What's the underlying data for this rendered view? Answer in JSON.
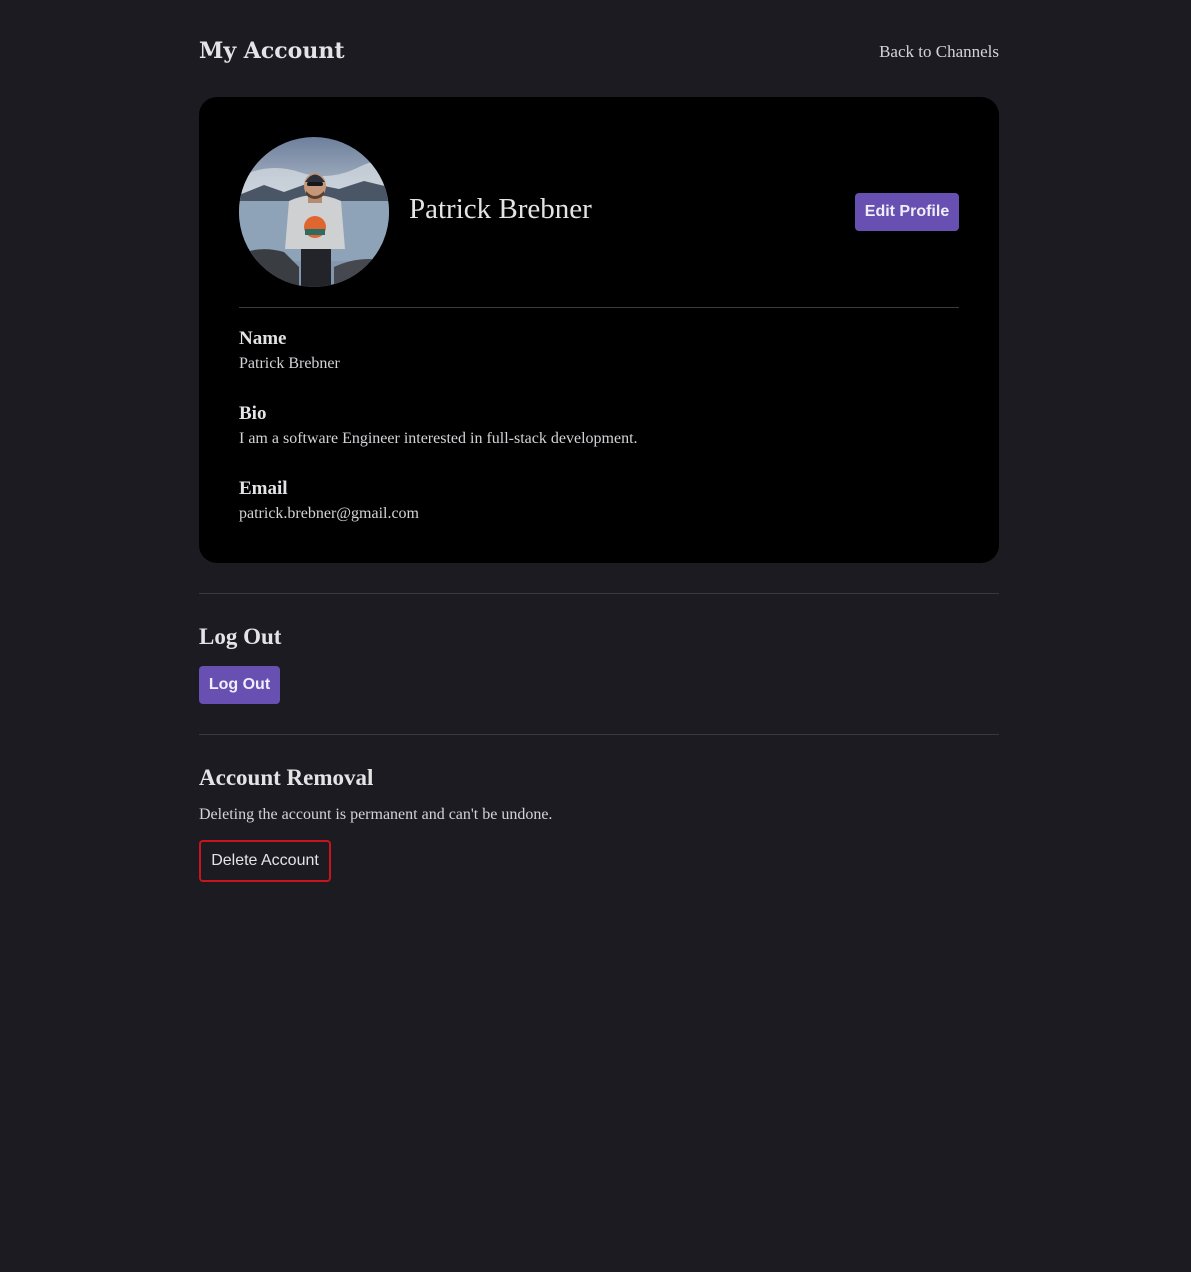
{
  "header": {
    "title": "My Account",
    "back_link": "Back to Channels"
  },
  "profile": {
    "display_name": "Patrick Brebner",
    "edit_button": "Edit Profile",
    "avatar_alt": "Profile photo",
    "fields": [
      {
        "label": "Name",
        "value": "Patrick Brebner"
      },
      {
        "label": "Bio",
        "value": "I am a software Engineer interested in full-stack development."
      },
      {
        "label": "Email",
        "value": "patrick.brebner@gmail.com"
      }
    ]
  },
  "logout": {
    "title": "Log Out",
    "button": "Log Out"
  },
  "removal": {
    "title": "Account Removal",
    "description": "Deleting the account is permanent and can't be undone.",
    "button": "Delete Account"
  },
  "colors": {
    "background": "#1c1b21",
    "card": "#000000",
    "accent": "#6750b1",
    "danger": "#c8141c"
  }
}
